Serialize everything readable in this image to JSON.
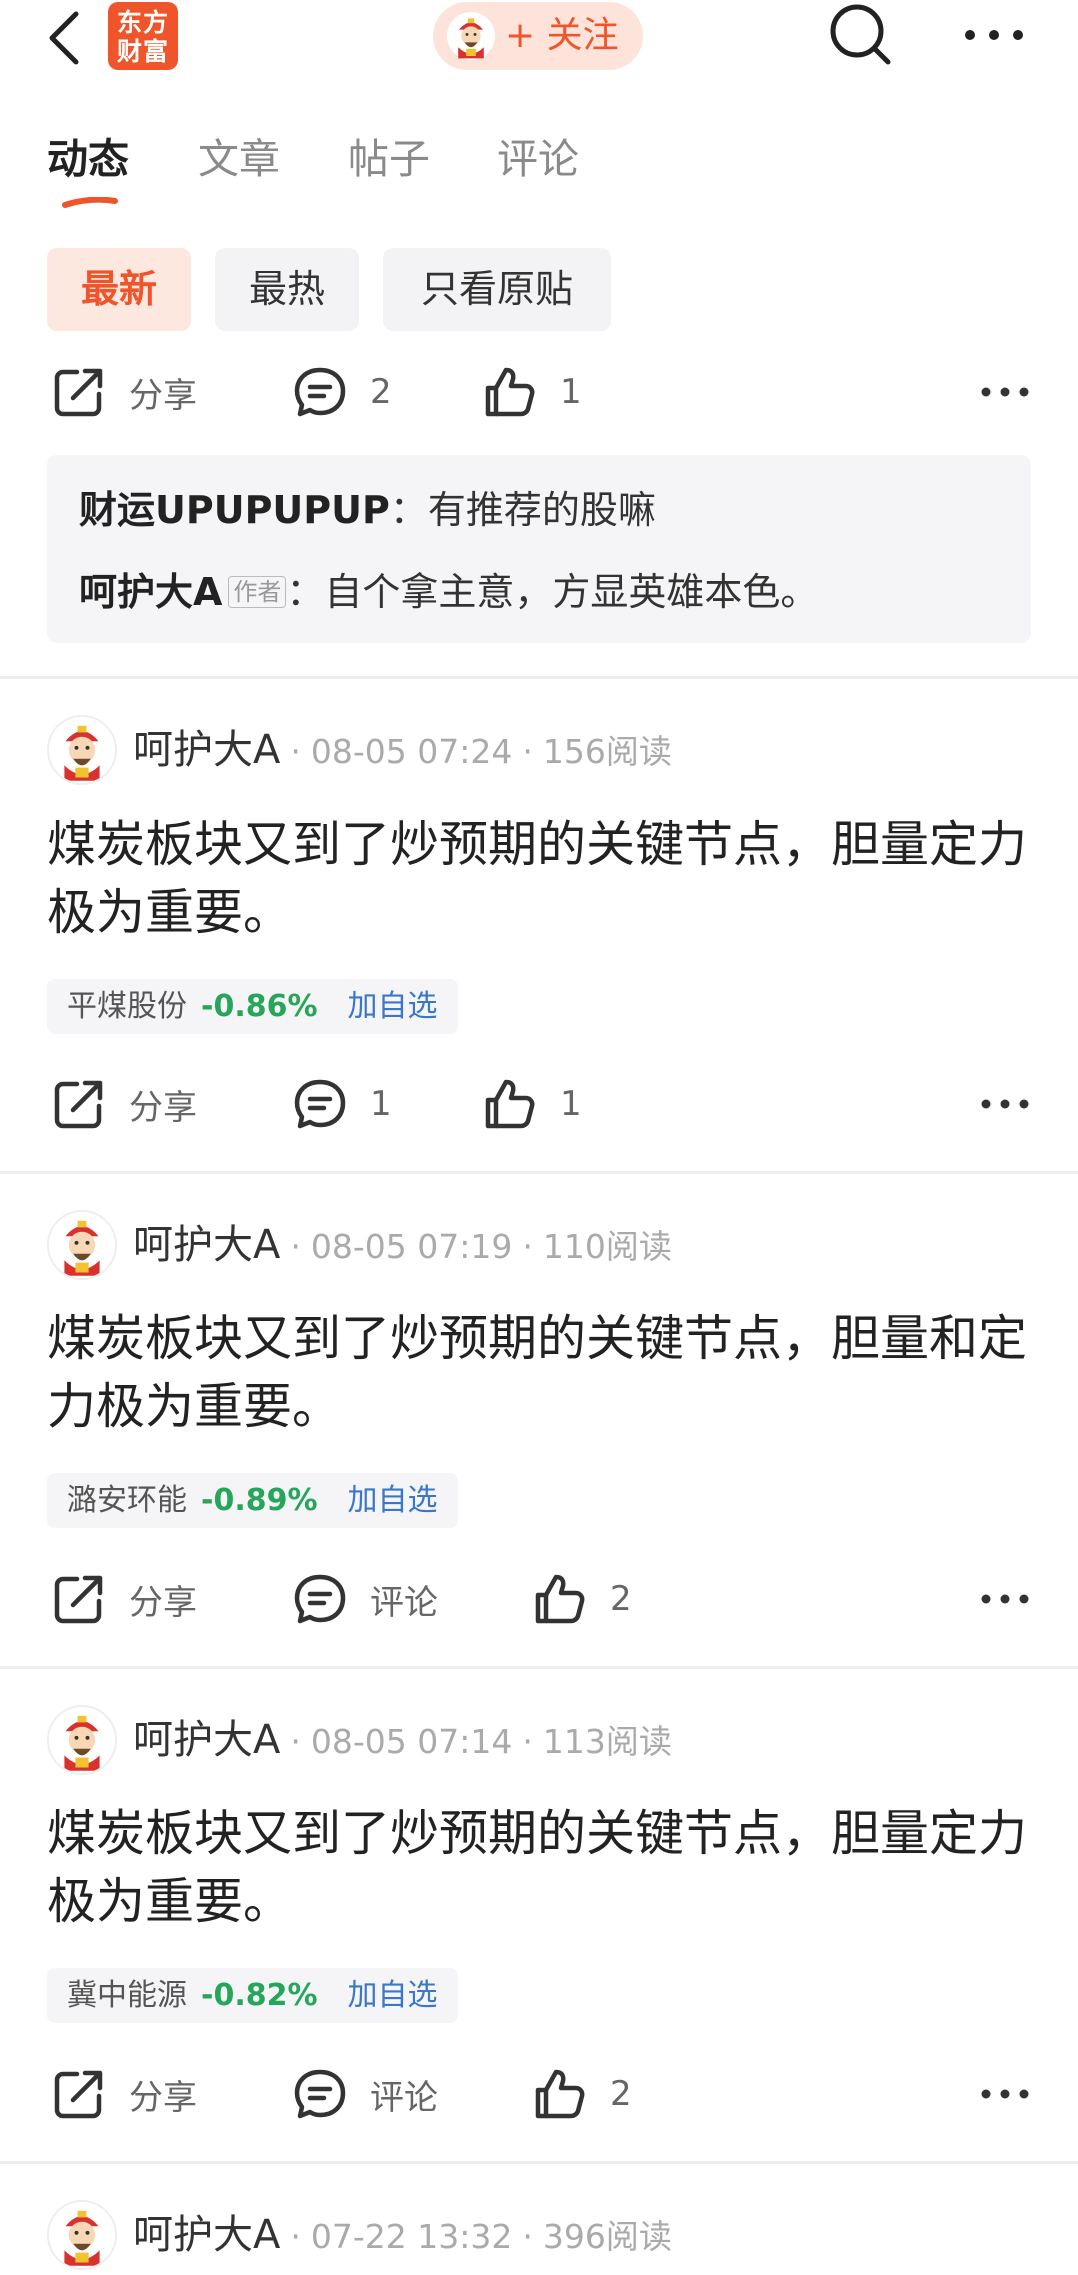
{
  "header": {
    "logo_line1": "东方",
    "logo_line2": "财富",
    "follow_label": "+ 关注"
  },
  "tabs": [
    {
      "label": "动态",
      "active": true
    },
    {
      "label": "文章",
      "active": false
    },
    {
      "label": "帖子",
      "active": false
    },
    {
      "label": "评论",
      "active": false
    }
  ],
  "filters": [
    {
      "label": "最新",
      "active": true
    },
    {
      "label": "最热",
      "active": false
    },
    {
      "label": "只看原贴",
      "active": false
    }
  ],
  "first_actions": {
    "share": "分享",
    "comments": "2",
    "likes": "1"
  },
  "comment_box": {
    "c1_user": "财运UPUPUPUP",
    "c1_text": "：有推荐的股嘛",
    "c2_user": "呵护大A",
    "c2_tag": "作者",
    "c2_text": "：自个拿主意，方显英雄本色。"
  },
  "posts": [
    {
      "user": "呵护大A",
      "time": "08-05 07:24",
      "reads": "156阅读",
      "text": "煤炭板块又到了炒预期的关键节点，胆量定力极为重要。",
      "stock": {
        "name": "平煤股份",
        "change": "-0.86%",
        "add": "加自选"
      },
      "share": "分享",
      "comments": "1",
      "likes": "1"
    },
    {
      "user": "呵护大A",
      "time": "08-05 07:19",
      "reads": "110阅读",
      "text": "煤炭板块又到了炒预期的关键节点，胆量和定力极为重要。",
      "stock": {
        "name": "潞安环能",
        "change": "-0.89%",
        "add": "加自选"
      },
      "share": "分享",
      "comments": "评论",
      "likes": "2"
    },
    {
      "user": "呵护大A",
      "time": "08-05 07:14",
      "reads": "113阅读",
      "text": "煤炭板块又到了炒预期的关键节点，胆量定力极为重要。",
      "stock": {
        "name": "冀中能源",
        "change": "-0.82%",
        "add": "加自选"
      },
      "share": "分享",
      "comments": "评论",
      "likes": "2"
    },
    {
      "user": "呵护大A",
      "time": "07-22 13:32",
      "reads": "396阅读"
    }
  ],
  "colors": {
    "accent": "#f0542a",
    "down": "#27a55a",
    "link": "#3a77c9"
  }
}
